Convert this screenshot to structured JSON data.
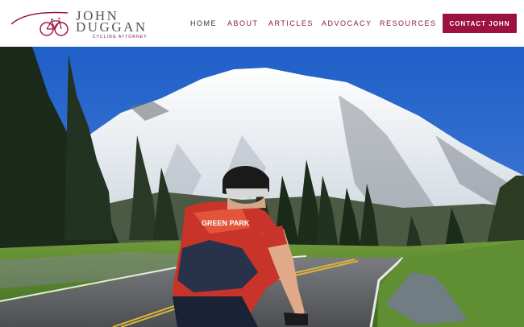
{
  "brand": {
    "name_line1": "JOHN",
    "name_line2": "DUGGAN",
    "tagline": "CYCLING ATTORNEY"
  },
  "nav": {
    "items": [
      {
        "label": "HOME",
        "active": true
      },
      {
        "label": "ABOUT",
        "active": false
      },
      {
        "label": "ARTICLES",
        "active": false
      },
      {
        "label": "ADVOCACY",
        "active": false
      },
      {
        "label": "RESOURCES",
        "active": false
      }
    ],
    "cta_label": "CONTACT JOHN"
  },
  "hero": {
    "jersey_logo": "GREEN PARK"
  },
  "colors": {
    "brand": "#9b1240",
    "nav_text": "#8a1a3a",
    "nav_active": "#333333"
  }
}
